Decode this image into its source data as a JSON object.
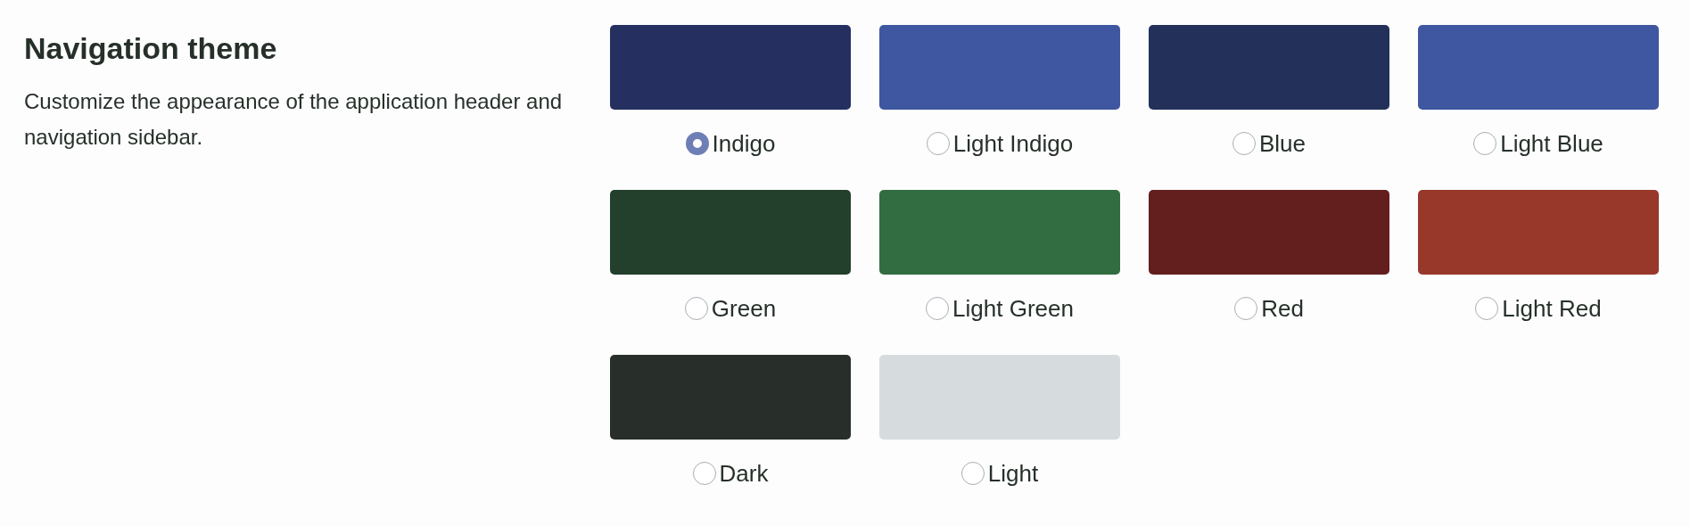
{
  "section": {
    "title": "Navigation theme",
    "description": "Customize the appearance of the application header and navigation sidebar."
  },
  "themes": [
    {
      "label": "Indigo",
      "color": "#253060",
      "selected": true
    },
    {
      "label": "Light Indigo",
      "color": "#3f57a0",
      "selected": false
    },
    {
      "label": "Blue",
      "color": "#22305a",
      "selected": false
    },
    {
      "label": "Light Blue",
      "color": "#3f56a0",
      "selected": false
    },
    {
      "label": "Green",
      "color": "#22402c",
      "selected": false
    },
    {
      "label": "Light Green",
      "color": "#326c41",
      "selected": false
    },
    {
      "label": "Red",
      "color": "#631f1d",
      "selected": false
    },
    {
      "label": "Light Red",
      "color": "#98382b",
      "selected": false
    },
    {
      "label": "Dark",
      "color": "#282e29",
      "selected": false
    },
    {
      "label": "Light",
      "color": "#d6dbde",
      "selected": false
    }
  ]
}
